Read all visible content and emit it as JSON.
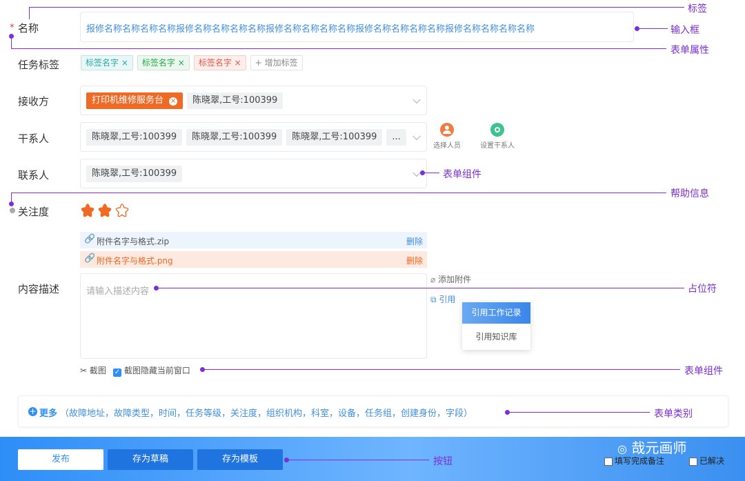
{
  "annotations": {
    "tag_label": "标签",
    "input_box": "输入框",
    "form_attr": "表单属性",
    "form_component_1": "表单组件",
    "help_info": "帮助信息",
    "placeholder": "占位符",
    "form_component_2": "表单组件",
    "form_category": "表单类别",
    "button": "按钮"
  },
  "form": {
    "required_star": "*",
    "name_label": "名称",
    "name_value": "报修名称名称名称名称报修名称名称名称名称报修名称名称名称名称报修名称名称名称名称报修名称名称名称名称",
    "tags_label": "任务标签",
    "tags": [
      {
        "text": "标签名字",
        "color": "#2aa7a7"
      },
      {
        "text": "标签名字",
        "color": "#29a84a"
      },
      {
        "text": "标签名字",
        "color": "#e0594a"
      }
    ],
    "tag_close": "×",
    "add_tag": "+ 增加标签",
    "receiver_label": "接收方",
    "receiver_primary": "打印机维修服务台",
    "receiver_primary_close": "×",
    "receiver_secondary": "陈晓翠,工号:100399",
    "stakeholder_label": "干系人",
    "stakeholders": [
      "陈晓翠,工号:100399",
      "陈晓翠,工号:100399",
      "陈晓翠,工号:100399"
    ],
    "stakeholder_more": "...",
    "select_person": "选择人员",
    "set_stakeholder": "设置干系人",
    "contact_label": "联系人",
    "contact_value": "陈晓翠,工号:100399",
    "attention_label": "关注度",
    "attention_rating": 2,
    "attention_max": 3,
    "attachments": [
      {
        "name": "附件名字与格式.zip",
        "action": "删除"
      },
      {
        "name": "附件名字与格式.png",
        "action": "删除"
      }
    ],
    "desc_label": "内容描述",
    "desc_placeholder": "请输入描述内容",
    "add_attachment": "添加附件",
    "quote": "引用",
    "quote_menu": [
      "引用工作记录",
      "引用知识库"
    ],
    "screenshot": "截图",
    "hide_window": "截图隐藏当前窗口",
    "more_title": "更多",
    "more_items": "（故障地址，故障类型，时间，任务等级，关注度，组织机构，科室，设备，任务组，创建身份，字段）"
  },
  "footer": {
    "publish": "发布",
    "save_draft": "存为草稿",
    "save_template": "存为模板",
    "fill_remark": "填写完成备注",
    "resolved": "已解决",
    "watermark": "哉元画师"
  },
  "colors": {
    "accent": "#2e8ef7",
    "annotation": "#7b2ed6",
    "orange": "#ee6a25",
    "star": "#f06a24"
  }
}
